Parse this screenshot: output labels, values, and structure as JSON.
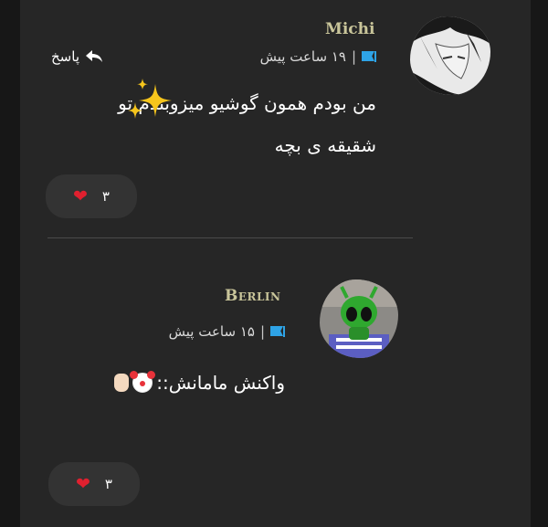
{
  "comments": [
    {
      "username": "Michi",
      "time": "۱۹ ساعت پیش",
      "separator": "|",
      "reply_label": "پاسخ",
      "lines": [
        "من بودم همون گوشیو میزوبندم تو",
        "شقیقه ی بچه"
      ],
      "reaction_count": "۳",
      "reaction_emoji": "heart",
      "avatar": "anime-character-avatar"
    },
    {
      "username": "Berlin",
      "time": "۱۵ ساعت پیش",
      "separator": "|",
      "text": "واکنش مامانش::",
      "text_emojis": [
        "clown-face",
        "raised-hand"
      ],
      "reaction_count": "۳",
      "reaction_emoji": "heart",
      "avatar": "green-alien-toy-avatar"
    }
  ],
  "colors": {
    "background": "#262626",
    "username": "#c9c59a",
    "flag": "#2ea3e6",
    "heart": "#e0202f",
    "pill": "#333333"
  }
}
